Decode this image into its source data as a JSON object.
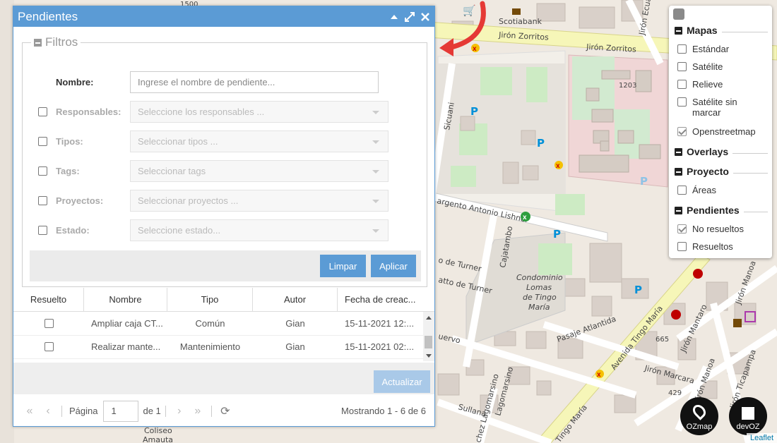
{
  "window": {
    "title": "Pendientes"
  },
  "filters": {
    "legend": "Filtros",
    "nombre_label": "Nombre:",
    "nombre_placeholder": "Ingrese el nombre de pendiente...",
    "rows": [
      {
        "label": "Responsables:",
        "placeholder": "Seleccione los responsables ..."
      },
      {
        "label": "Tipos:",
        "placeholder": "Seleccionar tipos ..."
      },
      {
        "label": "Tags:",
        "placeholder": "Seleccionar tags"
      },
      {
        "label": "Proyectos:",
        "placeholder": "Seleccionar proyectos ..."
      },
      {
        "label": "Estado:",
        "placeholder": "Seleccione estado..."
      }
    ],
    "clear_label": "Limpar",
    "apply_label": "Aplicar"
  },
  "grid": {
    "columns": [
      "Resuelto",
      "Nombre",
      "Tipo",
      "Autor",
      "Fecha de creac..."
    ],
    "rows": [
      {
        "nombre": "Ampliar caja CT...",
        "tipo": "Común",
        "autor": "Gian",
        "fecha": "15-11-2021 12:..."
      },
      {
        "nombre": "Realizar mante...",
        "tipo": "Mantenimiento",
        "autor": "Gian",
        "fecha": "15-11-2021 02:..."
      }
    ],
    "update_label": "Actualizar"
  },
  "pager": {
    "page_label": "Página",
    "page_value": "1",
    "of_label": "de 1",
    "showing": "Mostrando 1 - 6 de 6"
  },
  "layers": {
    "groups": [
      {
        "title": "Mapas",
        "items": [
          {
            "label": "Estándar",
            "checked": false
          },
          {
            "label": "Satélite",
            "checked": false
          },
          {
            "label": "Relieve",
            "checked": false
          },
          {
            "label": "Satélite sin marcar",
            "checked": false
          },
          {
            "label": "Openstreetmap",
            "checked": true
          }
        ]
      },
      {
        "title": "Overlays",
        "items": []
      },
      {
        "title": "Proyecto",
        "items": [
          {
            "label": "Áreas",
            "checked": false
          }
        ]
      },
      {
        "title": "Pendientes",
        "items": [
          {
            "label": "No resueltos",
            "checked": true
          },
          {
            "label": "Resueltos",
            "checked": false
          }
        ]
      }
    ]
  },
  "map": {
    "labels": {
      "zorritos1": "Jirón Zorritos",
      "zorritos2": "Jirón Zorritos",
      "ecuador": "Jirón Ecuador",
      "scotiabank": "Scotiabank",
      "sicuani": "Sicuani",
      "lishner": "argento Antonio Lishner",
      "cajatambo": "Cajatambo",
      "turner1": "o de Turner",
      "turner2": "atto de Turner",
      "condominio1": "Condominio",
      "condominio2": "Lomas",
      "condominio3": "de Tingo",
      "condominio4": "María",
      "atlantida": "Pasaje Atlantida",
      "tingo1": "Avenida Tingo María",
      "tingo2": "Tingo María",
      "mantaro": "Jirón Mantaro",
      "marcara": "Jirón Marcara",
      "manoa1": "Jirón Manoa",
      "manoa2": "Jirón Manoa",
      "ticapampa": "Jirón Ticapampa",
      "sullana": "Sullana",
      "lagomarsino": "Lagomarsino",
      "chez": "chez Lagomarsino",
      "uervo": "uervo",
      "coliseo1": "Coliseo",
      "coliseo2": "Amauta",
      "n1203": "1203",
      "n665": "665",
      "n429": "429",
      "n1500": "1500"
    },
    "accent_colors": {
      "window": "#5b9bd5",
      "arrow": "#e53935"
    }
  },
  "badges": {
    "ozmap": "OZmap",
    "devoz": "devOZ"
  },
  "attribution": "Leaflet"
}
